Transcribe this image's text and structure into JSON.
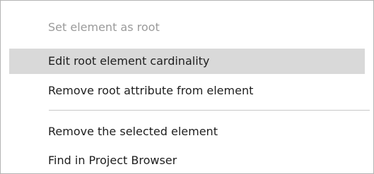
{
  "context_menu": {
    "items": [
      {
        "label": "Set element as root",
        "state": "disabled"
      },
      {
        "label": "Edit root element cardinality",
        "state": "highlighted"
      },
      {
        "label": "Remove root attribute from element",
        "state": "normal"
      },
      {
        "label": "Remove the selected element",
        "state": "normal"
      },
      {
        "label": "Find in Project Browser",
        "state": "normal"
      }
    ],
    "colors": {
      "highlight": "#d9d9d9",
      "disabled_text": "#9a9a9a",
      "text": "#1e1e1e"
    }
  }
}
